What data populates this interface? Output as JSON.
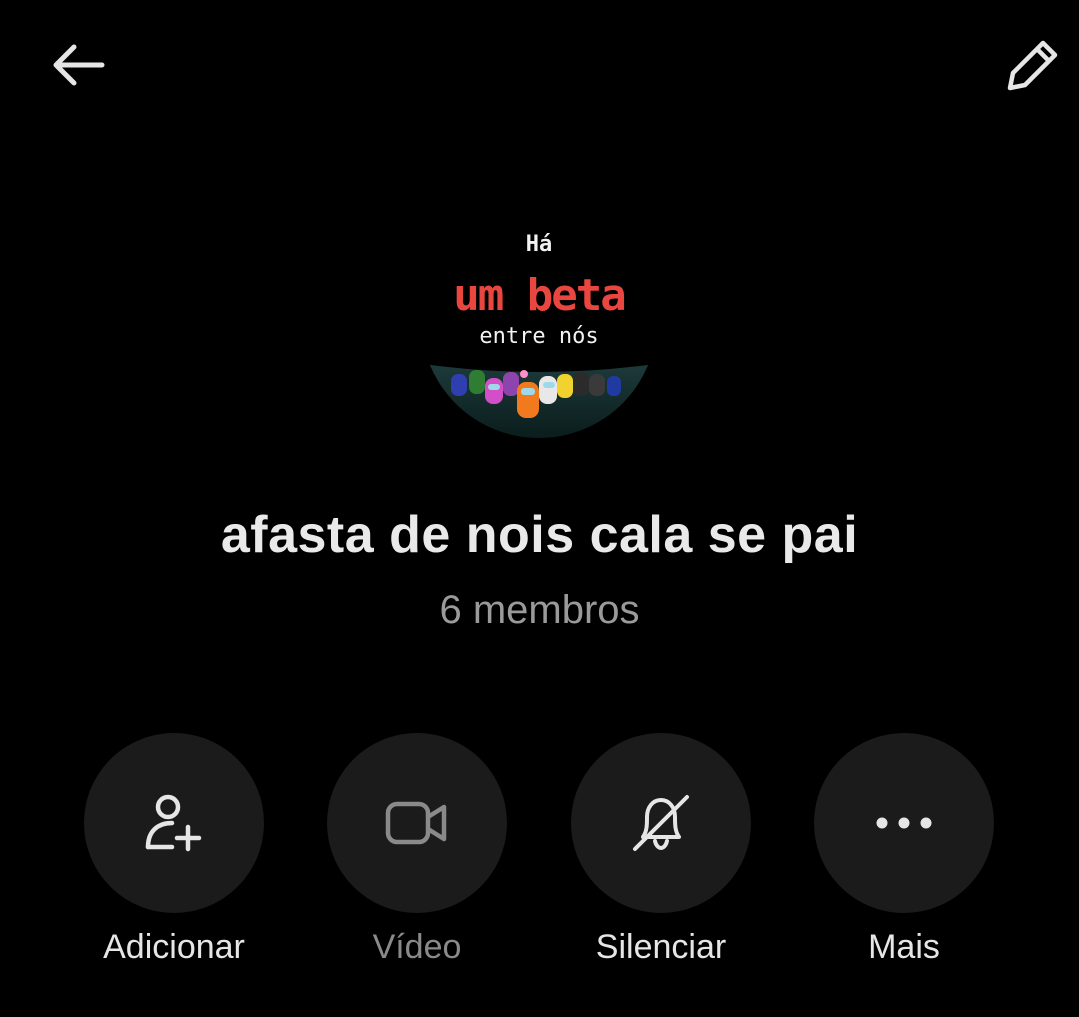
{
  "header": {
    "back_icon": "arrow-left-icon",
    "edit_icon": "pencil-icon"
  },
  "avatar": {
    "line1": "Há",
    "line2": "um beta",
    "line3": "entre nós"
  },
  "group": {
    "name": "afasta de nois cala se pai",
    "members": "6 membros"
  },
  "actions": [
    {
      "label": "Adicionar",
      "icon": "add-person-icon"
    },
    {
      "label": "Vídeo",
      "icon": "video-camera-icon"
    },
    {
      "label": "Silenciar",
      "icon": "bell-muted-icon"
    },
    {
      "label": "Mais",
      "icon": "more-dots-icon"
    }
  ],
  "colors": {
    "background": "#000000",
    "button_bg": "#1b1b1b",
    "title": "#e9e9e9",
    "subtitle": "#9a9a9a",
    "disabled": "#8a8a8a",
    "avatar_accent": "#e8463f"
  }
}
